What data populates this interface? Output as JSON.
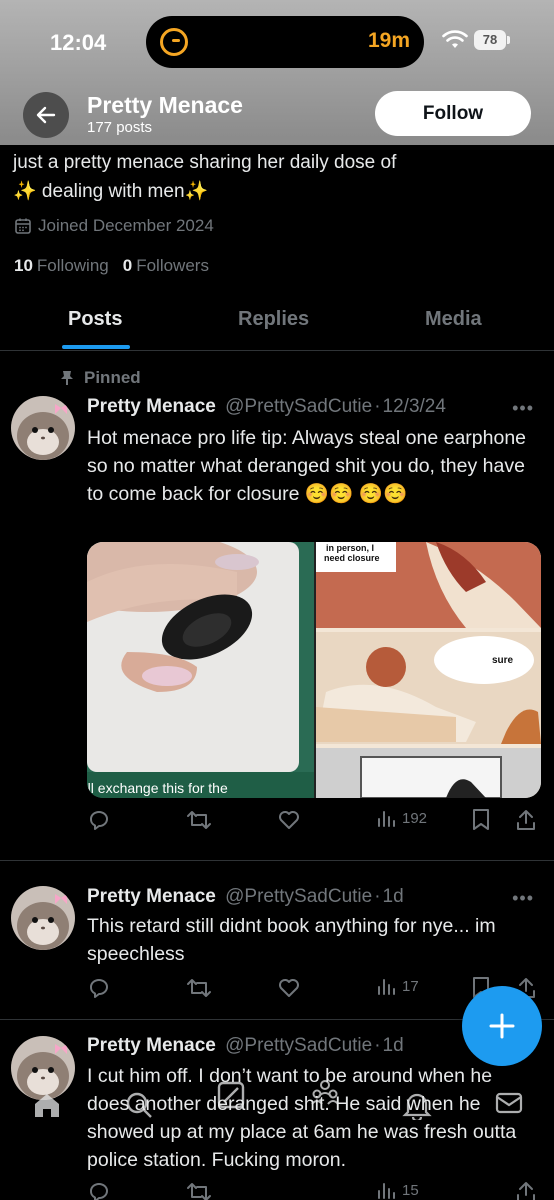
{
  "status_bar": {
    "time": "12:04",
    "timer": "19m",
    "battery": "78"
  },
  "header": {
    "name": "Pretty Menace",
    "posts_count": "177 posts",
    "follow_label": "Follow"
  },
  "profile": {
    "bio_line1": "just a pretty menace sharing her daily dose of",
    "bio_line2": "✨ dealing with men✨",
    "joined": "Joined December 2024",
    "following_count": "10",
    "following_label": "Following",
    "followers_count": "0",
    "followers_label": "Followers"
  },
  "tabs": [
    {
      "label": "Posts",
      "active": true
    },
    {
      "label": "Replies",
      "active": false
    },
    {
      "label": "Media",
      "active": false
    }
  ],
  "posts": [
    {
      "pinned_label": "Pinned",
      "name": "Pretty Menace",
      "handle": "@PrettySadCutie",
      "date": "12/3/24",
      "text": "Hot menace pro life tip: Always steal one earphone so no matter what deranged shit you do, they have to come back for closure ☺️☺️ ☺️☺️",
      "views": "192",
      "media": {
        "left_caption": "'ll exchange this for the",
        "comic_text_top": "in person, I need closure",
        "comic_text_sure": "sure"
      }
    },
    {
      "name": "Pretty Menace",
      "handle": "@PrettySadCutie",
      "date": "1d",
      "text": "This retard still didnt book anything for nye... im speechless",
      "views": "17"
    },
    {
      "name": "Pretty Menace",
      "handle": "@PrettySadCutie",
      "date": "1d",
      "text": "I cut him off. I don’t want to be around when he does another deranged shit. He said when he showed up at my place at 6am he was fresh outta police station. Fucking moron.",
      "views": "15"
    }
  ],
  "colors": {
    "accent": "#1d9bf0",
    "muted": "#71767b",
    "text": "#e7e9ea",
    "background": "#000000"
  }
}
